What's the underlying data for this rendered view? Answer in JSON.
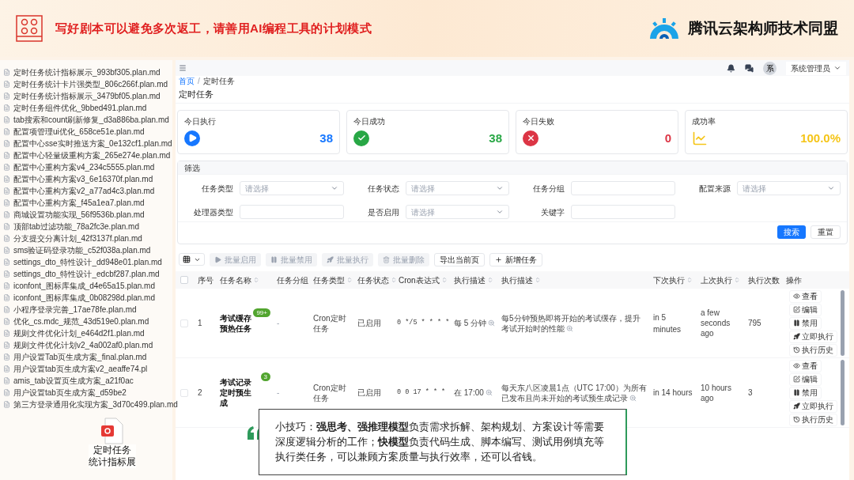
{
  "slide": {
    "title": "写好剧本可以避免多次返工，请善用AI编程工具的计划模式",
    "brand": "腾讯云架构师技术同盟"
  },
  "file_list": {
    "items": [
      "定时任务统计指标展示_993bf305.plan.md",
      "定时任务统计卡片强类型_806c266f.plan.md",
      "定时任务统计指标展示_3479bf05.plan.md",
      "定时任务组件优化_9bbed491.plan.md",
      "tab搜索和count刷新修复_d3a886ba.plan.md",
      "配置项管理ui优化_658ce51e.plan.md",
      "配置中心sse实时推送方案_0e132cf1.plan.md",
      "配置中心轻量级重构方案_265e274e.plan.md",
      "配置中心重构方案v4_234c5555.plan.md",
      "配置中心重构方案v3_6e16370f.plan.md",
      "配置中心重构方案v2_a77ad4c3.plan.md",
      "配置中心重构方案_f45a1ea7.plan.md",
      "商城设置功能实现_56f9536b.plan.md",
      "顶部tab过滤功能_78a2fc3e.plan.md",
      "分支提交分离计划_42f3137f.plan.md",
      "sms验证码登录功能_c52f038a.plan.md",
      "settings_dto_特性设计_dd948e01.plan.md",
      "settings_dto_特性设计_edcbf287.plan.md",
      "iconfont_图标库集成_d4e65a15.plan.md",
      "iconfont_图标库集成_0b08298d.plan.md",
      "小程序登录完善_17ae78fe.plan.md",
      "优化_cs.mdc_规范_43d519e0.plan.md",
      "规则文件优化计划_e464d2f1.plan.md",
      "规则文件优化计划v2_4a002af0.plan.md",
      "用户设置Tab页生成方案_final.plan.md",
      "用户设置tab页生成方案v2_aeaffe74.pl",
      "amis_tab设置页生成方案_a21f0ac",
      "用户设置tab页生成方案_d59be2",
      "第三方登录通用化实现方案_3d70c499.plan.md"
    ]
  },
  "drag_file": {
    "label_lines": [
      "定时任务",
      "统计指标展"
    ]
  },
  "app": {
    "topbar": {
      "avatar": "系",
      "user": "系统管理员"
    },
    "breadcrumb": {
      "separator": "/",
      "items": [
        "首页",
        "定时任务"
      ]
    },
    "page_title": "定时任务",
    "stats": [
      {
        "label": "今日执行",
        "value": "38",
        "kind": "run",
        "color": "#1677ff"
      },
      {
        "label": "今日成功",
        "value": "38",
        "kind": "success",
        "color": "#28a745"
      },
      {
        "label": "今日失败",
        "value": "0",
        "kind": "fail",
        "color": "#dc3545"
      },
      {
        "label": "成功率",
        "value": "100.0%",
        "kind": "rate",
        "color": "#f5c518"
      }
    ],
    "filter": {
      "title": "筛选",
      "fields": [
        {
          "label": "任务类型",
          "kind": "select",
          "placeholder": "请选择"
        },
        {
          "label": "任务状态",
          "kind": "select",
          "placeholder": "请选择"
        },
        {
          "label": "任务分组",
          "kind": "input"
        },
        {
          "label": "配置来源",
          "kind": "select",
          "placeholder": "请选择"
        },
        {
          "label": "处理器类型",
          "kind": "input"
        },
        {
          "label": "是否启用",
          "kind": "select",
          "placeholder": "请选择"
        },
        {
          "label": "关键字",
          "kind": "input"
        }
      ],
      "buttons": [
        {
          "label": "搜索",
          "kind": "primary"
        },
        {
          "label": "重置",
          "kind": "default"
        }
      ]
    },
    "toolbar": [
      {
        "label": "批量启用",
        "kind": "enable",
        "disabled": true
      },
      {
        "label": "批量禁用",
        "kind": "disable",
        "disabled": true
      },
      {
        "label": "批量执行",
        "kind": "execute",
        "disabled": true
      },
      {
        "label": "批量删除",
        "kind": "delete",
        "disabled": true
      },
      {
        "label": "导出当前页",
        "kind": "export",
        "disabled": false
      },
      {
        "label": "新增任务",
        "kind": "add",
        "disabled": false
      }
    ],
    "table": {
      "select_all_checked": false,
      "columns": [
        {
          "label": "序号",
          "sortable": false
        },
        {
          "label": "任务名称",
          "sortable": true
        },
        {
          "label": "任务分组",
          "sortable": false
        },
        {
          "label": "任务类型",
          "sortable": true
        },
        {
          "label": "任务状态",
          "sortable": true
        },
        {
          "label": "Cron表达式",
          "sortable": true
        },
        {
          "label": "执行描述",
          "sortable": true
        },
        {
          "label": "执行描述",
          "sortable": true
        },
        {
          "label": "下次执行",
          "sortable": true
        },
        {
          "label": "上次执行",
          "sortable": true
        },
        {
          "label": "执行次数",
          "sortable": false
        },
        {
          "label": "操作",
          "sortable": false
        }
      ],
      "rows": [
        {
          "checked": false,
          "index": "1",
          "name": "考试缓存预热任务",
          "badge": "99+",
          "group": "-",
          "type": "Cron定时任务",
          "status": "已启用",
          "cron": "0 */5 * * * *",
          "schedule": "每 5 分钟",
          "description": "每5分钟预热即将开始的考试缓存，提升考试开始时的性能",
          "next_run": "in 5 minutes",
          "last_run": "a few seconds ago",
          "run_count": "795",
          "actions": [
            {
              "label": "查看",
              "kind": "view"
            },
            {
              "label": "编辑",
              "kind": "edit"
            },
            {
              "label": "禁用",
              "kind": "disable"
            },
            {
              "label": "立即执行",
              "kind": "execute"
            },
            {
              "label": "执行历史",
              "kind": "history"
            }
          ]
        },
        {
          "checked": false,
          "index": "2",
          "name": "考试记录定时预生成",
          "badge": "3",
          "group": "-",
          "type": "Cron定时任务",
          "status": "已启用",
          "cron": "0 0 17 * * *",
          "schedule": "在 17:00",
          "description": "每天东八区凌晨1点（UTC 17:00）为所有已发布且尚未开始的考试预生成记录",
          "next_run": "in 14 hours",
          "last_run": "10 hours ago",
          "run_count": "3",
          "actions": [
            {
              "label": "查看",
              "kind": "view"
            },
            {
              "label": "编辑",
              "kind": "edit"
            },
            {
              "label": "禁用",
              "kind": "disable"
            },
            {
              "label": "立即执行",
              "kind": "execute"
            },
            {
              "label": "执行历史",
              "kind": "history"
            }
          ]
        }
      ]
    }
  },
  "tip": {
    "text": "小技巧：**强思考、强推理模型**负责需求拆解、架构规划、方案设计等需要深度逻辑分析的工作；**快模型**负责代码生成、脚本编写、测试用例填充等执行类任务，可以兼顾方案质量与执行效率，还可以省钱。"
  }
}
